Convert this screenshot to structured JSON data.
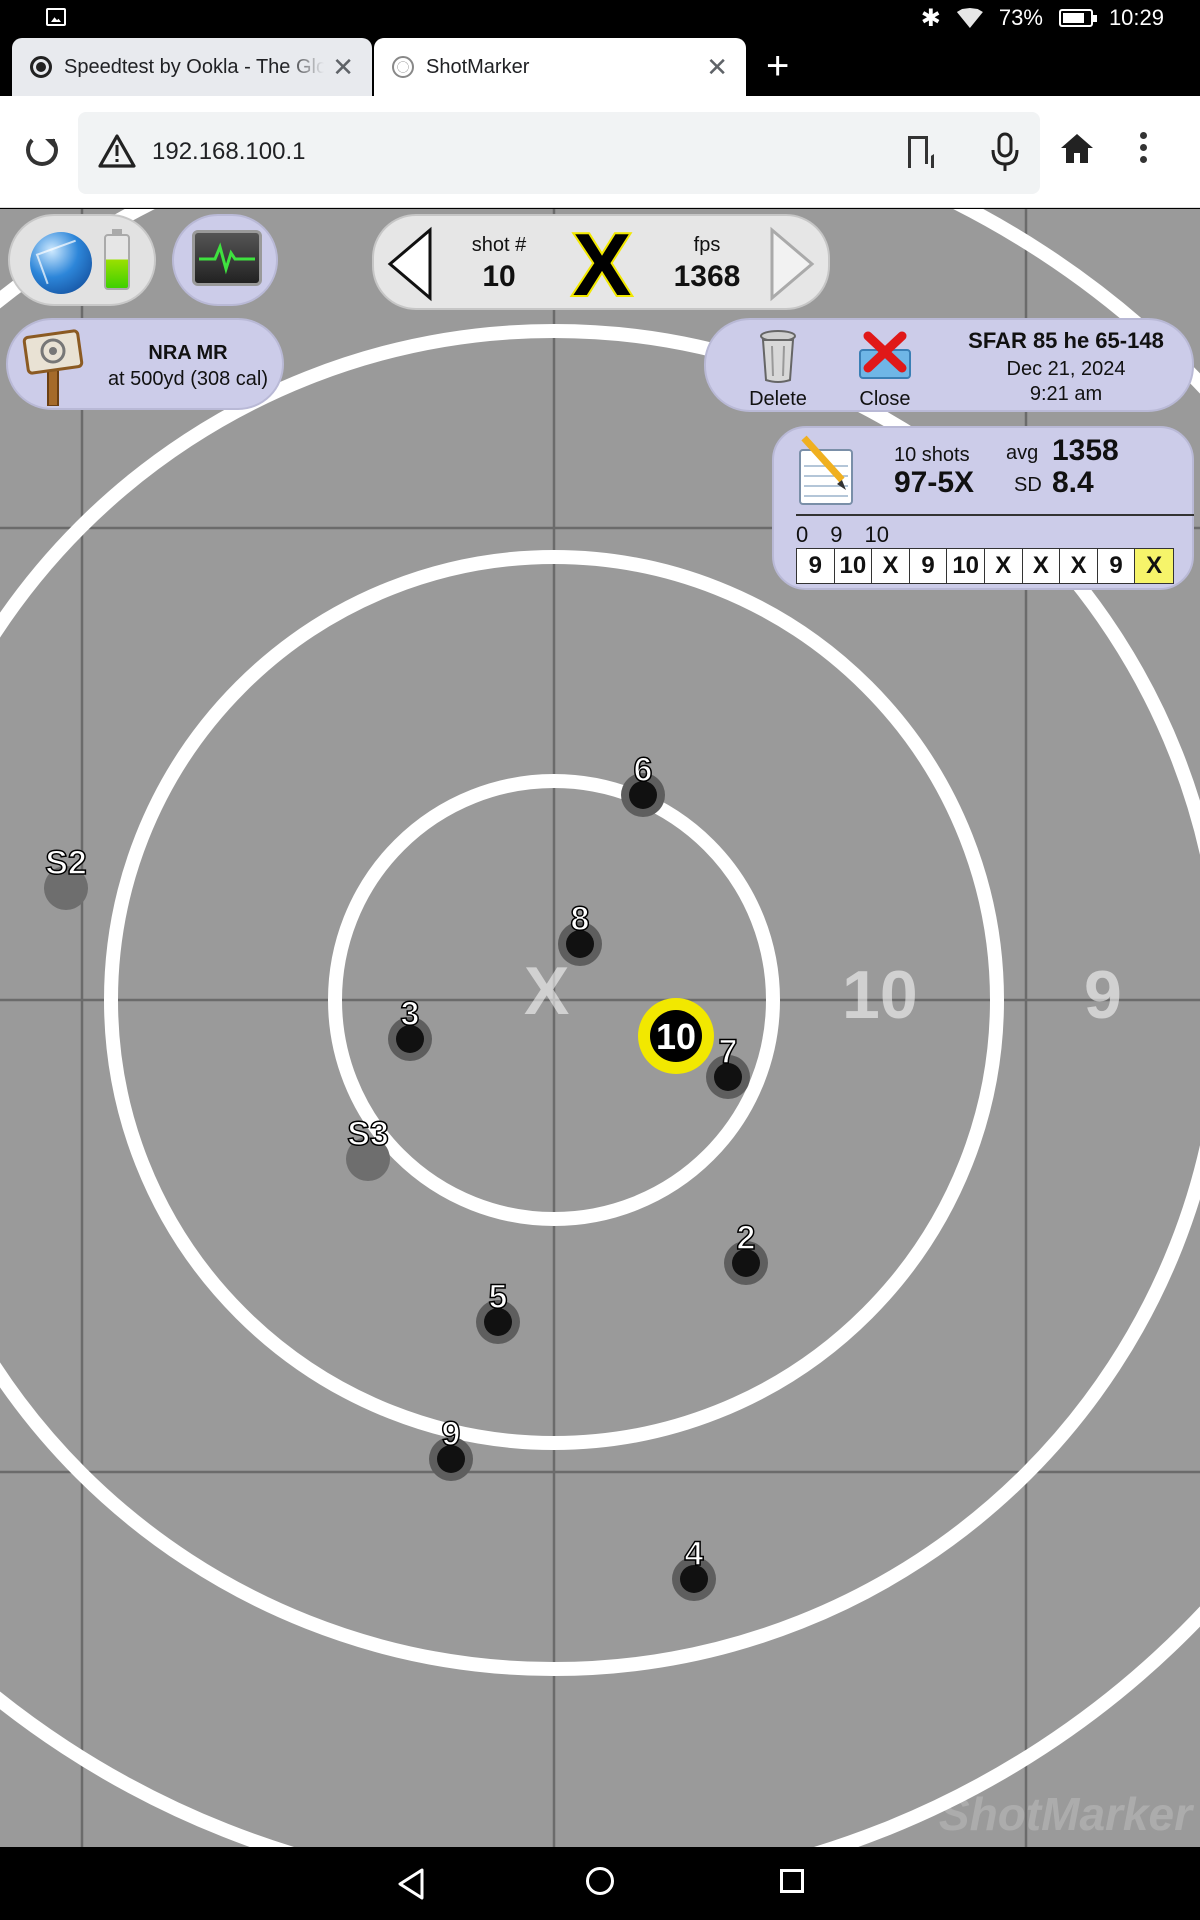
{
  "status_bar": {
    "battery": "73%",
    "time": "10:29"
  },
  "tabs": [
    {
      "title": "Speedtest by Ookla - The Glo",
      "active": false
    },
    {
      "title": "ShotMarker",
      "active": true
    }
  ],
  "toolbar": {
    "url": "192.168.100.1"
  },
  "nav": {
    "shot_label": "shot #",
    "shot_number": "10",
    "score": "X",
    "fps_label": "fps",
    "fps_value": "1368"
  },
  "course": {
    "title": "NRA MR",
    "subtitle": "at 500yd (308 cal)"
  },
  "record": {
    "delete_label": "Delete",
    "close_label": "Close",
    "title": "SFAR 85 he 65-148",
    "date": "Dec 21, 2024",
    "time": "9:21 am"
  },
  "stats": {
    "shots": "10 shots",
    "score": "97-5X",
    "avg_label": "avg",
    "avg": "1358",
    "sd_label": "SD",
    "sd": "8.4",
    "summary_head": [
      "0",
      "9",
      "10"
    ],
    "scores": [
      "9",
      "10",
      "X",
      "9",
      "10",
      "X",
      "X",
      "X",
      "9",
      "X"
    ],
    "highlight_index": 9
  },
  "target": {
    "center_label": "X",
    "ring_labels": [
      "10",
      "9"
    ],
    "watermark": "ShotMarker",
    "shots": [
      {
        "label": "S2",
        "type": "sighter"
      },
      {
        "label": "S3",
        "type": "sighter"
      },
      {
        "label": "2",
        "type": "record"
      },
      {
        "label": "3",
        "type": "record"
      },
      {
        "label": "4",
        "type": "record"
      },
      {
        "label": "5",
        "type": "record"
      },
      {
        "label": "6",
        "type": "record"
      },
      {
        "label": "7",
        "type": "record"
      },
      {
        "label": "8",
        "type": "record"
      },
      {
        "label": "9",
        "type": "record"
      },
      {
        "label": "10",
        "type": "current"
      }
    ]
  }
}
